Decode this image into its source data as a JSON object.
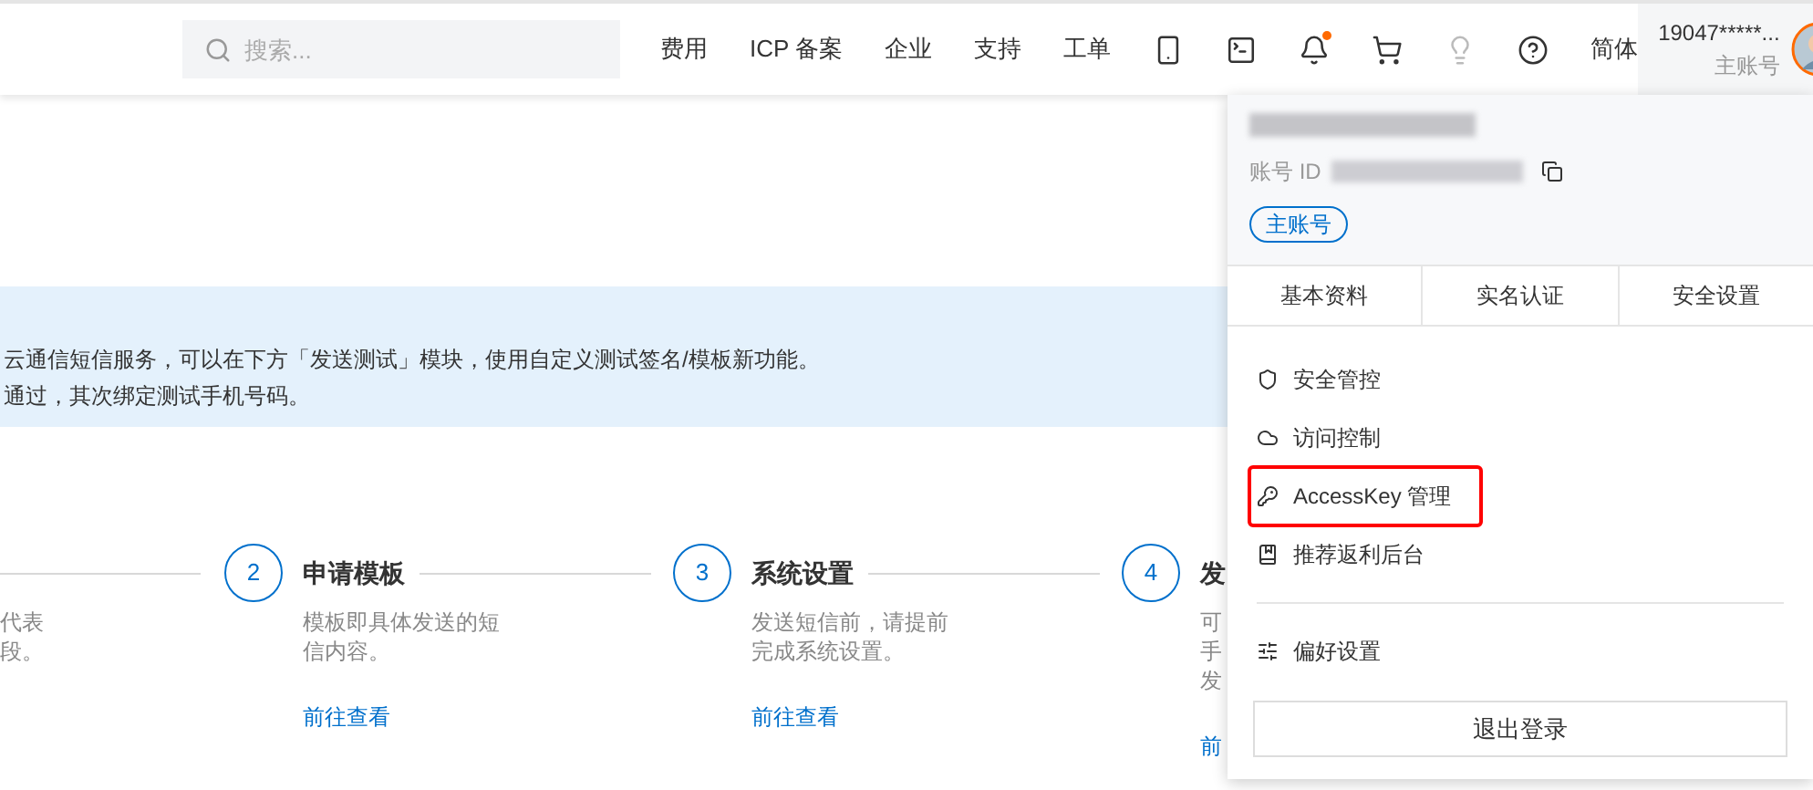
{
  "header": {
    "search": {
      "placeholder": "搜索..."
    },
    "nav": [
      {
        "kind": "text",
        "label": "费用"
      },
      {
        "kind": "text",
        "label": "ICP 备案"
      },
      {
        "kind": "text",
        "label": "企业"
      },
      {
        "kind": "text",
        "label": "支持"
      },
      {
        "kind": "text",
        "label": "工单"
      },
      {
        "kind": "app"
      },
      {
        "kind": "terminal"
      },
      {
        "kind": "bell",
        "notification": true
      },
      {
        "kind": "cart"
      },
      {
        "kind": "bulb"
      },
      {
        "kind": "help"
      },
      {
        "kind": "text",
        "label": "简体"
      }
    ],
    "account": {
      "name": "19047*****...",
      "role": "主账号"
    }
  },
  "banner": {
    "lines": [
      "云通信短信服务，可以在下方「发送测试」模块，使用自定义测试签名/模板新功能。",
      "通过，其次绑定测试手机号码。"
    ]
  },
  "steps": [
    {
      "description": [
        "代表",
        "段。"
      ]
    },
    {
      "number": "2",
      "title": "申请模板",
      "description": [
        "模板即具体发送的短",
        "信内容。"
      ],
      "link": "前往查看"
    },
    {
      "number": "3",
      "title": "系统设置",
      "description": [
        "发送短信前，请提前",
        "完成系统设置。"
      ],
      "link": "前往查看"
    },
    {
      "number": "4",
      "title": "发",
      "description": [
        "可",
        "手",
        "发"
      ],
      "link": "前"
    }
  ],
  "account_menu": {
    "id_label": "账号 ID",
    "badge": "主账号",
    "tabs": [
      "基本资料",
      "实名认证",
      "安全设置"
    ],
    "items": [
      {
        "kind": "shield",
        "label": "安全管控",
        "highlighted": false
      },
      {
        "kind": "cloud",
        "label": "访问控制",
        "highlighted": false
      },
      {
        "kind": "key",
        "label": "AccessKey 管理",
        "highlighted": true
      },
      {
        "kind": "book",
        "label": "推荐返利后台",
        "highlighted": false
      },
      {
        "kind": "divider"
      },
      {
        "kind": "sliders",
        "label": "偏好设置",
        "highlighted": false
      }
    ],
    "logout": "退出登录"
  }
}
